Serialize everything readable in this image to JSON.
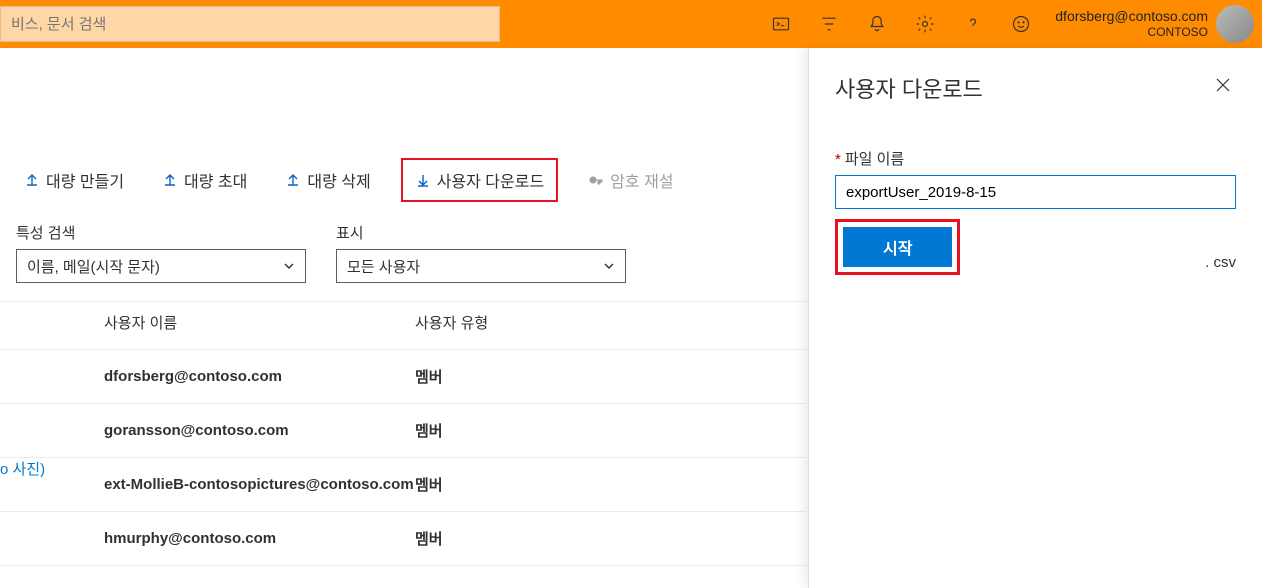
{
  "topbar": {
    "search_placeholder": "비스, 문서 검색",
    "account_email": "dforsberg@contoso.com",
    "account_org": "CONTOSO"
  },
  "toolbar": {
    "bulk_create": "대량 만들기",
    "bulk_invite": "대량 초대",
    "bulk_delete": "대량 삭제",
    "download_users": "사용자 다운로드",
    "password_reset": "암호 재설"
  },
  "filters": {
    "search_label": "특성 검색",
    "search_value": "이름, 메일(시작 문자)",
    "display_label": "표시",
    "display_value": "모든 사용자"
  },
  "table": {
    "col_name": "사용자 이름",
    "col_type": "사용자 유형",
    "rows": [
      {
        "prefix": "",
        "name": "dforsberg@contoso.com",
        "type": "멤버"
      },
      {
        "prefix": "",
        "name": "goransson@contoso.com",
        "type": "멤버"
      },
      {
        "prefix": "o 사진)",
        "name": "ext-MollieB-contosopictures@contoso.com",
        "type": "멤버"
      },
      {
        "prefix": "",
        "name": "hmurphy@contoso.com",
        "type": "멤버"
      }
    ]
  },
  "panel": {
    "title": "사용자 다운로드",
    "file_label": "파일 이름",
    "file_value": "exportUser_2019-8-15",
    "ext": ". csv",
    "start_btn": "시작"
  }
}
